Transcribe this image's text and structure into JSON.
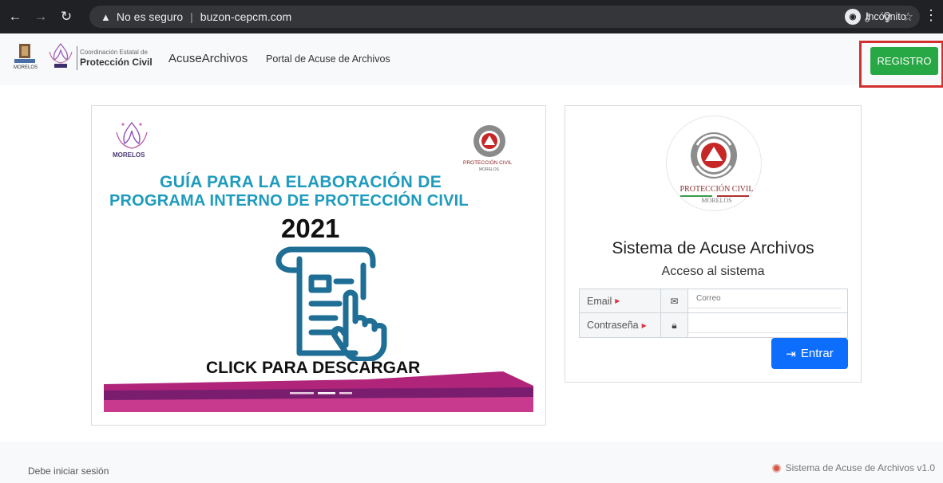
{
  "browser": {
    "security_label": "No es seguro",
    "url": "buzon-cepcm.com",
    "profile_label": "Incógnito"
  },
  "navbar": {
    "logo_a_text": "MORELOS",
    "logo_b_text": "MORELOS",
    "coord_small": "Coordinación Estatal de",
    "coord_big": "Protección Civil",
    "brand": "AcuseArchivos",
    "link": "Portal de Acuse de Archivos",
    "registro_label": "REGISTRO"
  },
  "guide": {
    "morelos": "MORELOS",
    "pc_label": "PROTECCIÓN CIVIL",
    "pc_sub": "MORELOS",
    "title_line1": "GUÍA PARA LA ELABORACIÓN DE",
    "title_line2": "PROGRAMA INTERNO DE PROTECCIÓN CIVIL",
    "year": "2021",
    "cta": "CLICK PARA DESCARGAR"
  },
  "login": {
    "logo_label": "PROTECCIÓN CIVIL",
    "logo_sub": "MORELOS",
    "title": "Sistema de Acuse Archivos",
    "subtitle": "Acceso al sistema",
    "email_label": "Email",
    "email_placeholder": "Correo",
    "password_label": "Contraseña",
    "password_placeholder": "",
    "submit_label": "Entrar"
  },
  "footer": {
    "left": "Debe iniciar sesión",
    "right": "Sistema de Acuse de Archivos v1.0"
  },
  "colors": {
    "accent_green": "#28a745",
    "accent_blue": "#0d6efd",
    "highlight_red": "#d32f2f",
    "guide_cyan": "#1e9bbd",
    "wave_magenta": "#b0257a"
  },
  "icons": [
    "back-icon",
    "forward-icon",
    "reload-icon",
    "warning-icon",
    "key-icon",
    "zoom-icon",
    "star-icon",
    "incognito-icon",
    "kebab-menu-icon",
    "envelope-icon",
    "lock-icon",
    "login-arrow-icon"
  ]
}
